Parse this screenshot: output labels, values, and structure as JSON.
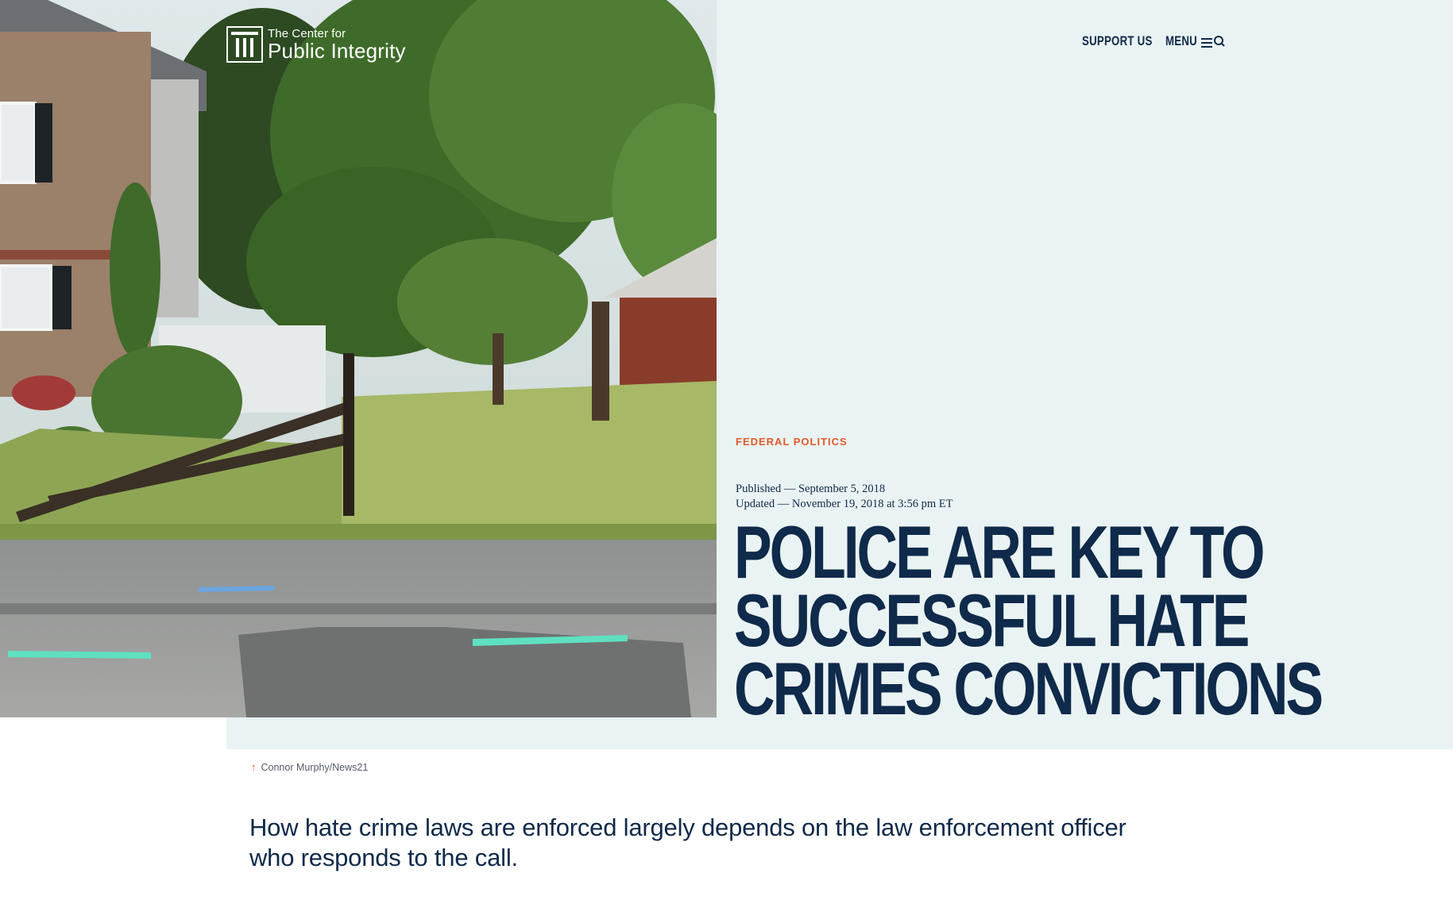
{
  "header": {
    "logo": {
      "line1": "The Center for",
      "line2": "Public Integrity",
      "icon": "column-pillar-icon"
    },
    "nav": {
      "support_label": "SUPPORT US",
      "menu_label": "MENU",
      "menu_icon": "menu-search-icon"
    }
  },
  "article": {
    "category": "FEDERAL POLITICS",
    "published": "Published — September 5, 2018",
    "updated": "Updated — November 19, 2018 at 3:56 pm ET",
    "headline_lines": [
      "POLICE ARE KEY TO",
      "SUCCESSFUL HATE",
      "CRIMES CONVICTIONS"
    ],
    "photo_credit": "Connor Murphy/News21",
    "credit_icon": "arrow-up-icon",
    "dek": "How hate crime laws are enforced largely depends on the law enforcement officer who responds to the call."
  },
  "colors": {
    "navy": "#0f2a4a",
    "accent": "#e05a2b",
    "hero_bg": "#eaf3f3"
  }
}
